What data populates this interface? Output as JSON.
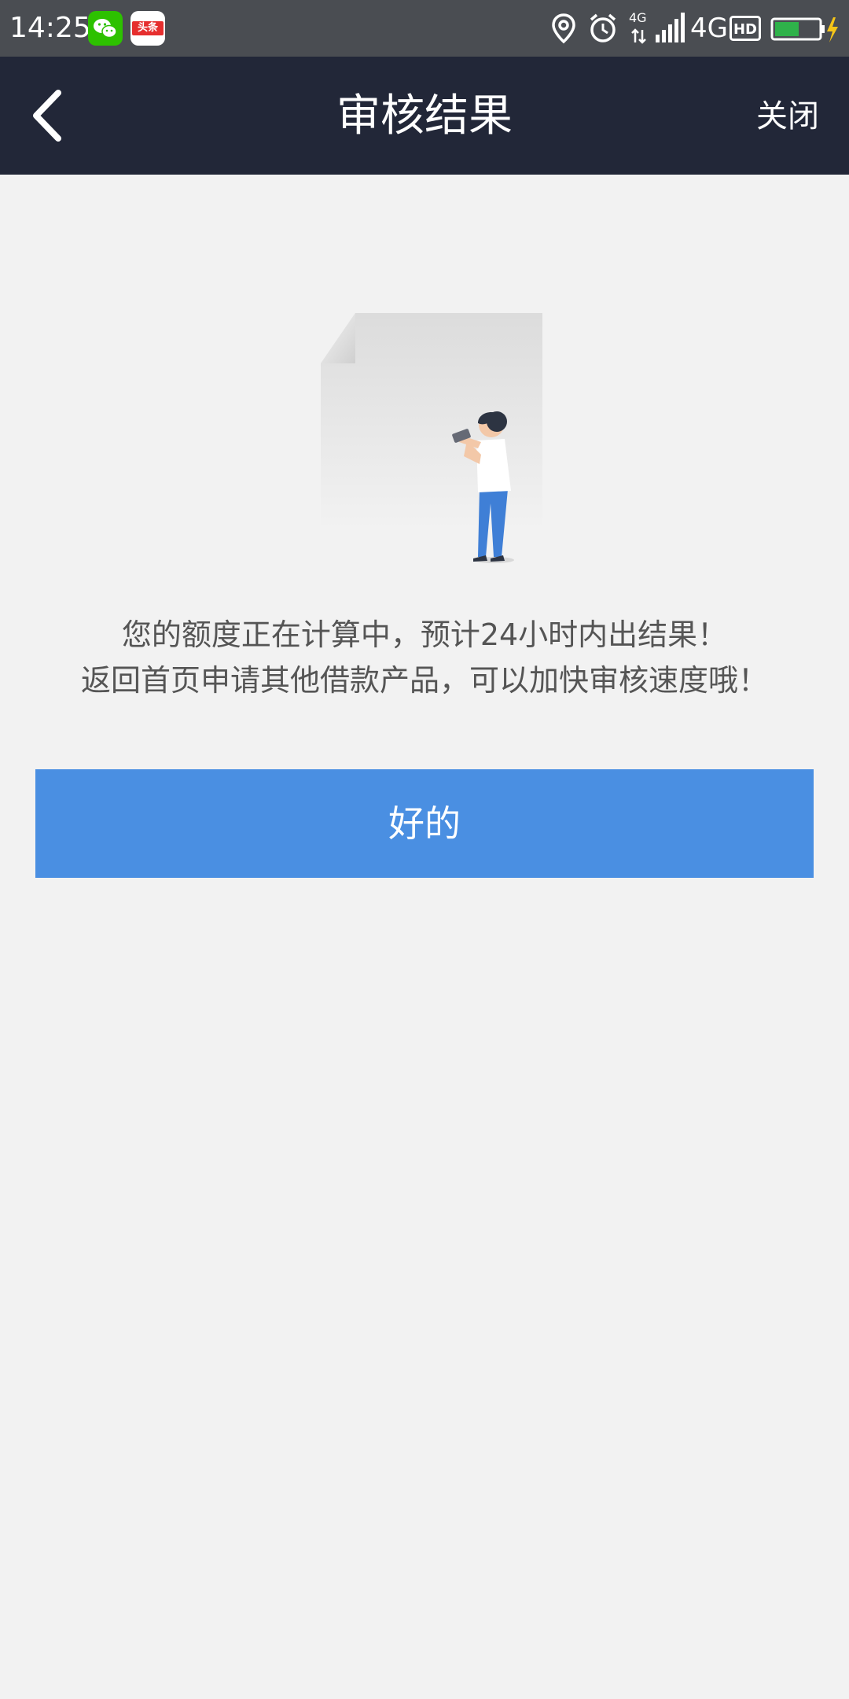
{
  "status_bar": {
    "time": "14:25",
    "apps": [
      {
        "name": "wechat-icon",
        "color": "#2dc100"
      },
      {
        "name": "toutiao-icon",
        "label": "头条",
        "color": "#e62e2e"
      }
    ],
    "network": "4G",
    "network_small": "4G",
    "hd_label": "HD",
    "battery_color": "#2fb24a",
    "background": "#4a4d52"
  },
  "nav": {
    "title": "审核结果",
    "close_label": "关闭",
    "back_icon": "chevron-left-icon",
    "background": "#222738"
  },
  "content": {
    "illustration": "document-with-person-illustration",
    "message_line1": "您的额度正在计算中，预计24小时内出结果！",
    "message_line2": "返回首页申请其他借款产品，可以加快审核速度哦！",
    "ok_label": "好的",
    "ok_color": "#4a8fe2"
  }
}
